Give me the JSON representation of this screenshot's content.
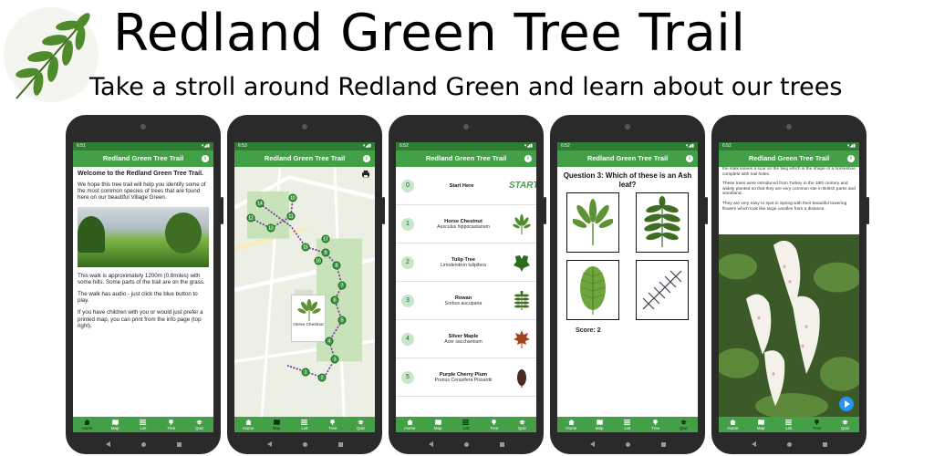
{
  "header": {
    "title": "Redland Green Tree Trail",
    "subtitle": "Take a stroll around Redland Green and learn about our trees"
  },
  "app": {
    "title": "Redland Green Tree Trail",
    "accent": "#43a047",
    "status_dark": "#2e7d32"
  },
  "nav": [
    "Home",
    "Map",
    "List",
    "Tree",
    "Quiz"
  ],
  "status_times": [
    "6:51",
    "6:53",
    "6:52",
    "6:52",
    "6:52"
  ],
  "home": {
    "heading": "Welcome to the Redland Green Tree Trail.",
    "para1": "We hope this tree trail will help you identify some of the most common species of trees that are found here on our beautiful Village Green.",
    "para2": "This walk is approximately 1200m (0.8miles) with some hills. Some parts of the trail are on the grass.",
    "para3": "The walk has audio - just click the blue button to play.",
    "para4": "If you have children with you or would just prefer a printed map, you can print from the info page (top right)."
  },
  "map": {
    "popup_title": "Horse Chestnut",
    "markers": [
      "1",
      "2",
      "3",
      "4",
      "5",
      "6",
      "7",
      "8",
      "9",
      "10",
      "11",
      "12",
      "13",
      "14",
      "15",
      "16",
      "17"
    ]
  },
  "list": {
    "items": [
      {
        "num": "0",
        "name": "Start Here",
        "latin": "",
        "icon": "start-label",
        "start_text": "START"
      },
      {
        "num": "1",
        "name": "Horse Chestnut",
        "latin": "Aesculus hippocastanum",
        "icon": "horse-chestnut-leaf-icon"
      },
      {
        "num": "2",
        "name": "Tulip Tree",
        "latin": "Liriodendron tulipifera",
        "icon": "tulip-leaf-icon"
      },
      {
        "num": "3",
        "name": "Rowan",
        "latin": "Sorbus aucuparia",
        "icon": "rowan-leaf-icon"
      },
      {
        "num": "4",
        "name": "Silver Maple",
        "latin": "Acer saccharinum",
        "icon": "maple-leaf-icon"
      },
      {
        "num": "5",
        "name": "Purple Cherry Plum",
        "latin": "Prunus Cerasifera Pissardii",
        "icon": "plum-leaf-icon"
      }
    ]
  },
  "quiz": {
    "question": "Question 3: Which of these is an Ash leaf?",
    "score": "Score: 2"
  },
  "detail": {
    "para1": "the stalk leaves a scar on the twig which is the shape of a horseshoe complete with nail holes.",
    "para2": "These trees were introduced from Turkey in the 16th century and widely planted so that they are very common site in British parks and woodland.",
    "para3": "They are very easy to spot in Spring with their beautiful towering flowers which look like large candles from a distance."
  }
}
